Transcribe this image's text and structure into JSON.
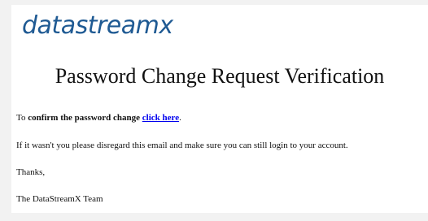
{
  "logo": {
    "text": "datastreamx"
  },
  "title": "Password Change Request Verification",
  "body": {
    "line1": {
      "prefix": "To ",
      "bold": "confirm the password change",
      "space": " ",
      "link": "click here",
      "suffix": "."
    },
    "line2": "If it wasn't you please disregard this email and make sure you can still login to your account.",
    "line3": "Thanks,",
    "line4": "The DataStreamX Team"
  },
  "colors": {
    "brand": "#1f5a93",
    "link": "#0000ee",
    "background": "#f2f2f2",
    "card": "#ffffff"
  }
}
